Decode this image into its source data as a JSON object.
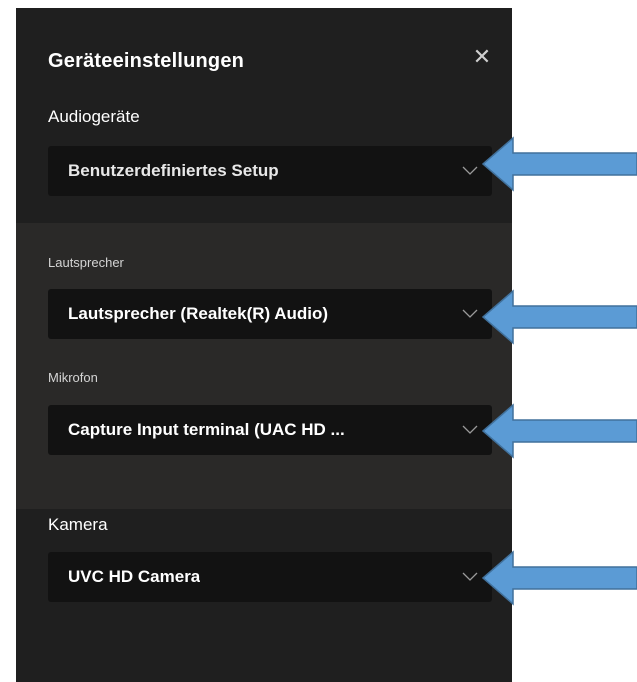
{
  "dialog": {
    "title": "Geräteeinstellungen",
    "close_icon": "close-icon"
  },
  "audio": {
    "label": "Audiogeräte",
    "selected": "Benutzerdefiniertes Setup"
  },
  "speaker": {
    "label": "Lautsprecher",
    "selected": "Lautsprecher (Realtek(R) Audio)"
  },
  "microphone": {
    "label": "Mikrofon",
    "selected": "Capture Input terminal (UAC HD ..."
  },
  "camera": {
    "label": "Kamera",
    "selected": "UVC HD Camera"
  },
  "annotation": {
    "arrow_color": "#5b9bd5"
  }
}
